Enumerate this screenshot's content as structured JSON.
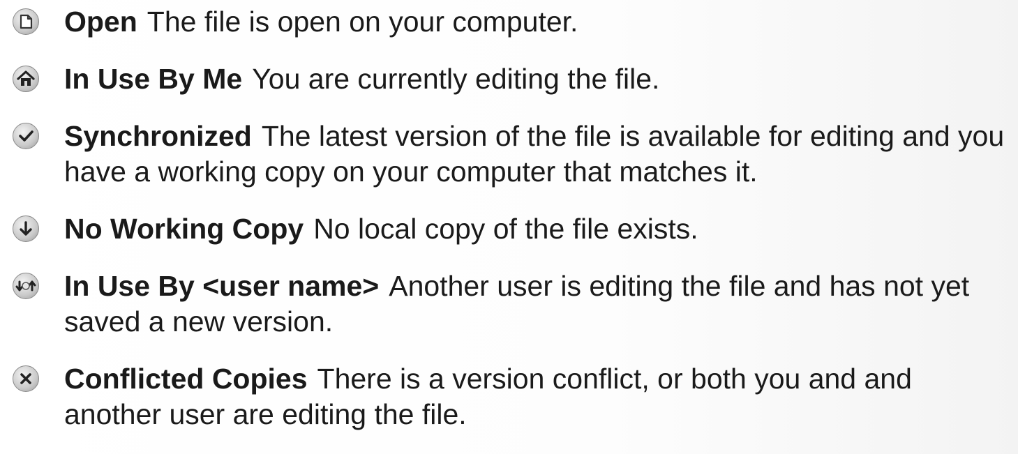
{
  "entries": [
    {
      "term": "Open",
      "description": "The file is open on your computer.",
      "icon": "open-icon"
    },
    {
      "term": "In Use By Me",
      "description": "You are currently editing the file.",
      "icon": "house-icon"
    },
    {
      "term": "Synchronized",
      "description": "The latest version of the file is available for editing and you have a working copy on your computer that matches it.",
      "icon": "checkmark-icon"
    },
    {
      "term": "No Working Copy",
      "description": "No local copy of the file exists.",
      "icon": "download-arrow-icon"
    },
    {
      "term": "In Use By <user name>",
      "description": "Another user is editing the file and has not yet saved a new version.",
      "icon": "sync-arrows-icon"
    },
    {
      "term": "Conflicted Copies",
      "description": "There is a version conflict, or both you and and another user are editing the file.",
      "icon": "x-icon"
    }
  ]
}
